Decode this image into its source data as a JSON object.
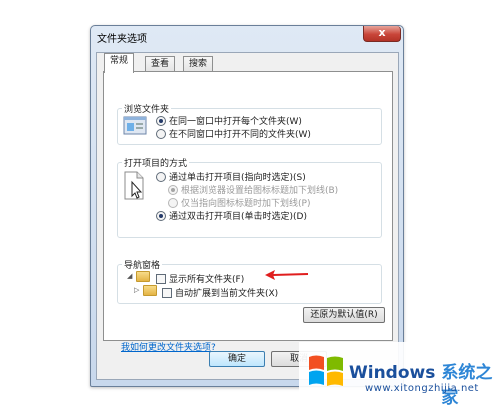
{
  "window": {
    "title": "文件夹选项",
    "close": "x"
  },
  "tabs": [
    {
      "label": "常规"
    },
    {
      "label": "查看"
    },
    {
      "label": "搜索"
    }
  ],
  "browse": {
    "label": "浏览文件夹",
    "opt1": "在同一窗口中打开每个文件夹(W)",
    "opt2": "在不同窗口中打开不同的文件夹(W)"
  },
  "open": {
    "label": "打开项目的方式",
    "single": "通过单击打开项目(指向时选定)(S)",
    "sub1": "根据浏览器设置给图标标题加下划线(B)",
    "sub2": "仅当指向图标标题时加下划线(P)",
    "double": "通过双击打开项目(单击时选定)(D)"
  },
  "nav": {
    "label": "导航窗格",
    "show_all": "显示所有文件夹(F)",
    "auto_expand": "自动扩展到当前文件夹(X)"
  },
  "restore_button": "还原为默认值(R)",
  "help_link": "我如何更改文件夹选项?",
  "ok_button": "确定",
  "cancel_button": "取消",
  "watermark": {
    "windows": "Windows",
    "cn": "系统之家",
    "url": "www.xitongzhijia.net"
  },
  "colors": {
    "arrow": "#e01e1e",
    "accent": "#1a4f9c"
  }
}
